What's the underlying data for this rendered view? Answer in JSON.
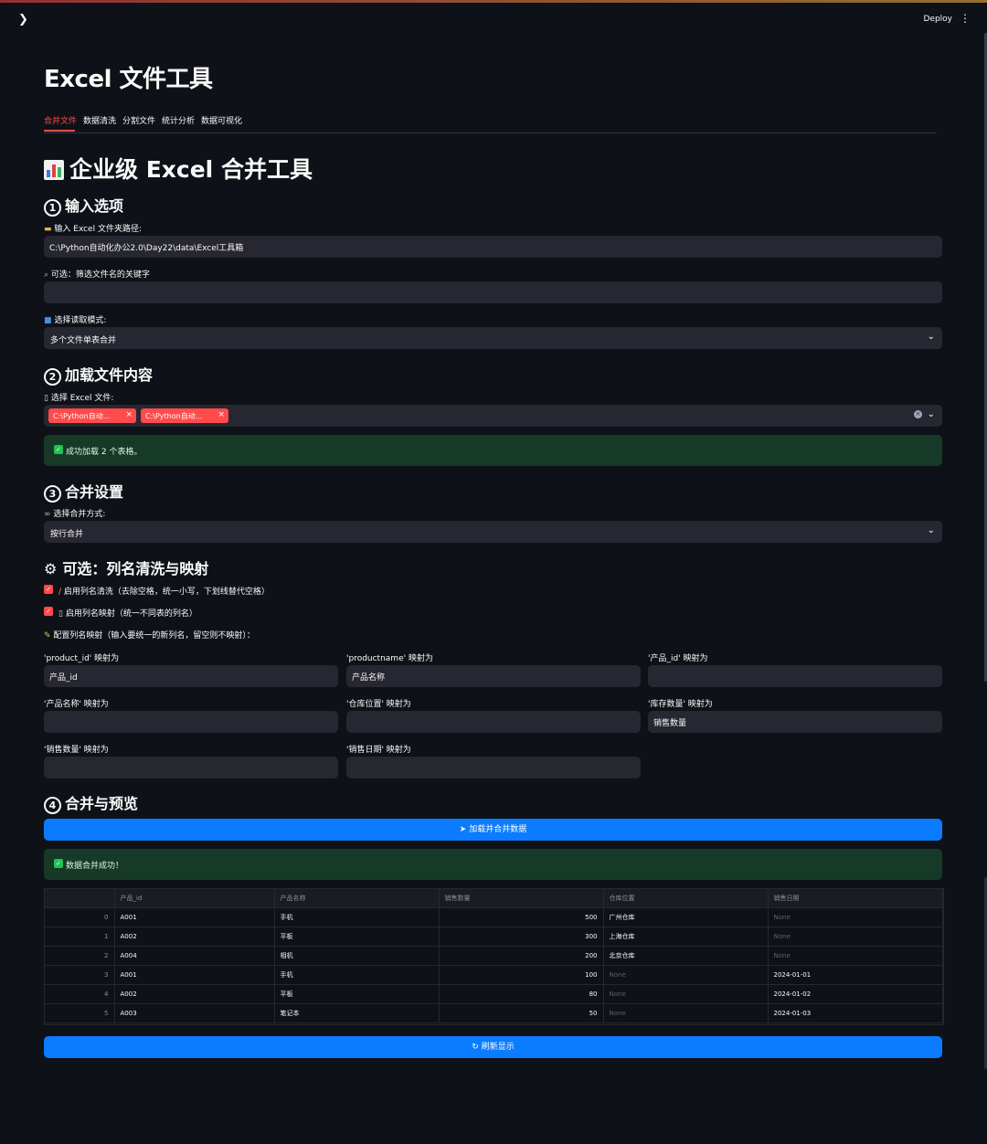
{
  "header": {
    "deploy_label": "Deploy"
  },
  "app_title": "Excel 文件工具",
  "tabs": [
    "合并文件",
    "数据清洗",
    "分割文件",
    "统计分析",
    "数据可视化"
  ],
  "page_heading": "企业级 Excel 合并工具",
  "section1": {
    "heading": "输入选项",
    "folder_label": "输入 Excel 文件夹路径:",
    "folder_value": "C:\\Python自动化办公2.0\\Day22\\data\\Excel工具箱",
    "keyword_label": "可选：筛选文件名的关键字",
    "keyword_value": "",
    "mode_label": "选择读取模式:",
    "mode_value": "多个文件单表合并"
  },
  "section2": {
    "heading": "加载文件内容",
    "files_label": "选择 Excel 文件:",
    "chips": [
      "C:\\Python自动...",
      "C:\\Python自动..."
    ],
    "success_msg": "成功加载 2 个表格。"
  },
  "section3": {
    "heading": "合并设置",
    "method_label": "选择合并方式:",
    "method_value": "按行合并"
  },
  "section_opt": {
    "heading": "可选：列名清洗与映射",
    "checkbox1": "启用列名清洗（去除空格，统一小写，下划线替代空格）",
    "checkbox2": "启用列名映射（统一不同表的列名）",
    "mapping_hint": "配置列名映射（输入要统一的新列名，留空则不映射）：",
    "mappings": [
      {
        "label": "'product_id' 映射为",
        "value": "产品_id"
      },
      {
        "label": "'productname' 映射为",
        "value": "产品名称"
      },
      {
        "label": "'产品_id' 映射为",
        "value": ""
      },
      {
        "label": "'产品名称' 映射为",
        "value": ""
      },
      {
        "label": "'仓库位置' 映射为",
        "value": ""
      },
      {
        "label": "'库存数量' 映射为",
        "value": "销售数量"
      },
      {
        "label": "'销售数量' 映射为",
        "value": ""
      },
      {
        "label": "'销售日期' 映射为",
        "value": ""
      }
    ]
  },
  "section4": {
    "heading": "合并与预览",
    "merge_button": "加载并合并数据",
    "success_msg": "数据合并成功！",
    "refresh_button": "刷新显示"
  },
  "table": {
    "columns": [
      "",
      "产品_id",
      "产品名称",
      "销售数量",
      "仓库位置",
      "销售日期"
    ],
    "rows": [
      [
        "0",
        "A001",
        "手机",
        "500",
        "广州仓库",
        "None"
      ],
      [
        "1",
        "A002",
        "平板",
        "300",
        "上海仓库",
        "None"
      ],
      [
        "2",
        "A004",
        "相机",
        "200",
        "北京仓库",
        "None"
      ],
      [
        "3",
        "A001",
        "手机",
        "100",
        "None",
        "2024-01-01"
      ],
      [
        "4",
        "A002",
        "平板",
        "80",
        "None",
        "2024-01-02"
      ],
      [
        "5",
        "A003",
        "笔记本",
        "50",
        "None",
        "2024-01-03"
      ]
    ]
  }
}
